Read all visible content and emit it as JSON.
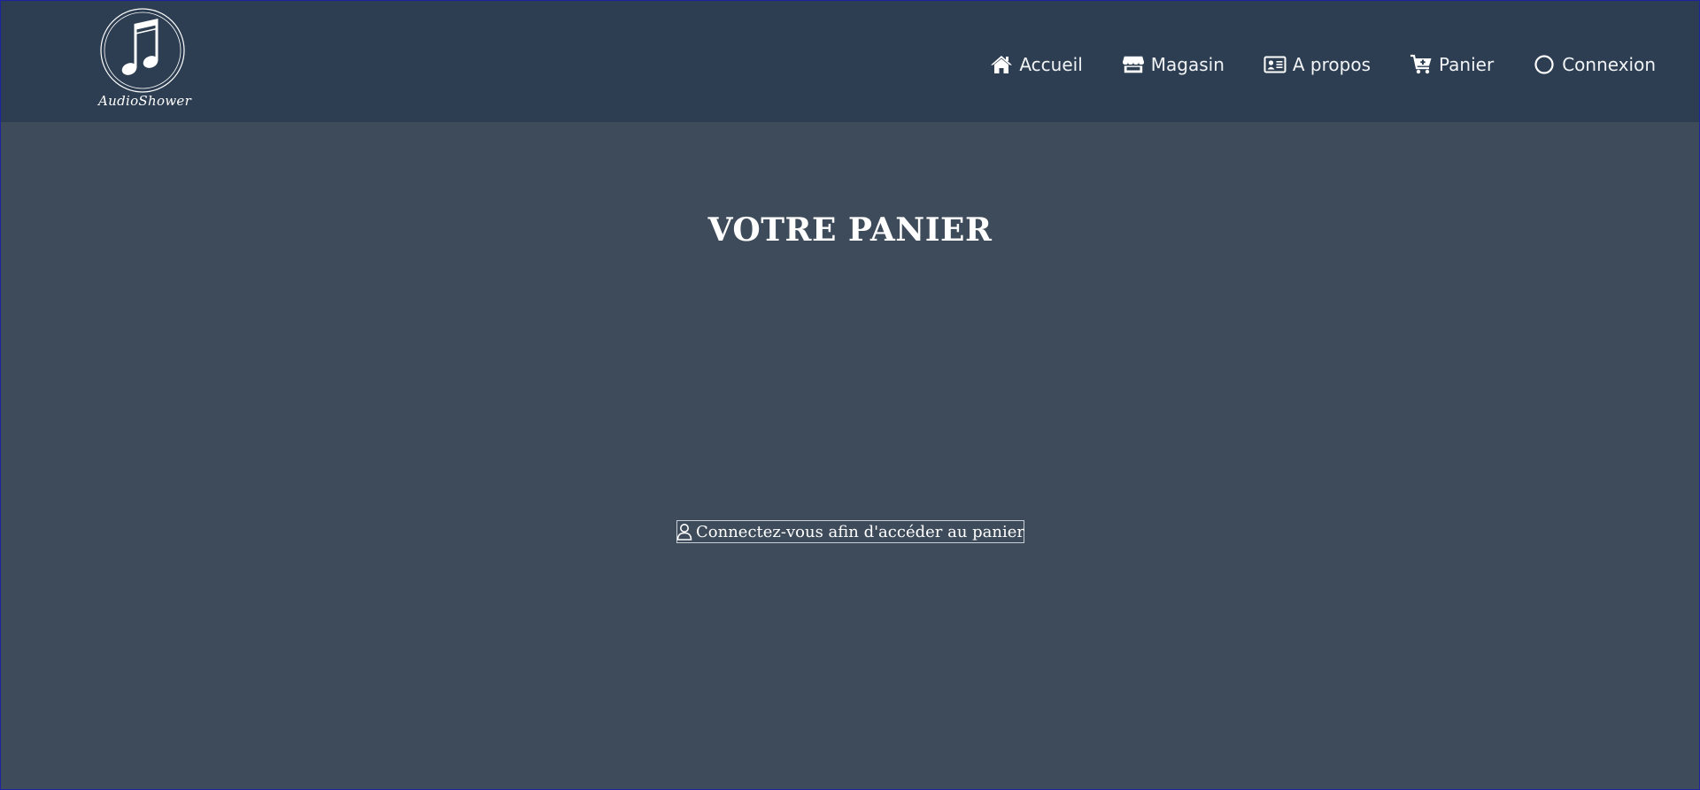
{
  "header": {
    "logo_text": "AudioShower",
    "nav": [
      {
        "label": "Accueil",
        "icon": "home-icon"
      },
      {
        "label": "Magasin",
        "icon": "store-icon"
      },
      {
        "label": "A propos",
        "icon": "id-card-icon"
      },
      {
        "label": "Panier",
        "icon": "cart-icon"
      },
      {
        "label": "Connexion",
        "icon": "circle-icon"
      }
    ]
  },
  "main": {
    "title": "VOTRE PANIER",
    "login_prompt": "Connectez-vous afin d'accéder au panier",
    "login_icon": "user-icon"
  },
  "colors": {
    "header_bg": "#2d3e52",
    "page_bg": "#3d4b5a",
    "text": "#ffffff"
  }
}
